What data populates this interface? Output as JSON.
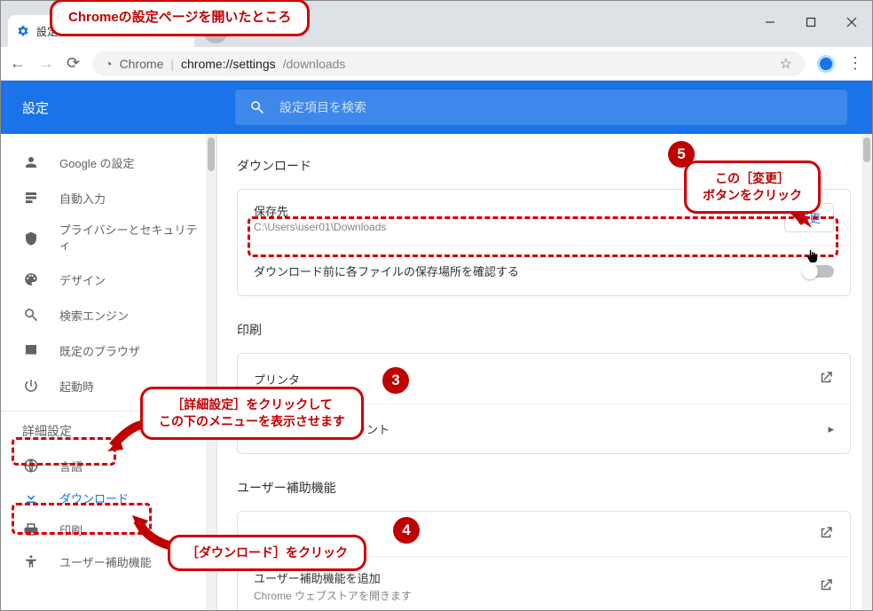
{
  "tab": {
    "title": "設定"
  },
  "addressbar": {
    "secure_label": "Chrome",
    "url_main": "chrome://settings",
    "url_rest": "/downloads"
  },
  "header": {
    "title": "設定",
    "search_placeholder": "設定項目を検索"
  },
  "sidebar": {
    "items": [
      {
        "label": "Google の設定"
      },
      {
        "label": "自動入力"
      },
      {
        "label": "プライバシーとセキュリティ"
      },
      {
        "label": "デザイン"
      },
      {
        "label": "検索エンジン"
      },
      {
        "label": "既定のブラウザ"
      },
      {
        "label": "起動時"
      }
    ],
    "advanced_label": "詳細設定",
    "sub_items": [
      {
        "label": "言語"
      },
      {
        "label": "ダウンロード"
      },
      {
        "label": "印刷"
      },
      {
        "label": "ユーザー補助機能"
      }
    ]
  },
  "main": {
    "download_section_title": "ダウンロード",
    "download_location_label": "保存先",
    "download_location_value": "C:\\Users\\user01\\Downloads",
    "download_change_button": "変更",
    "download_ask_label": "ダウンロード前に各ファイルの保存場所を確認する",
    "print_section_title": "印刷",
    "print_row_label": "プリンタ",
    "cloudprint_label": "Google クラウド プリント",
    "a11y_section_title": "ユーザー補助機能",
    "a11y_row1_main": "ユーザー補助機能を追加",
    "a11y_row1_sub": "Chrome ウェブストアを開きます"
  },
  "annotations": {
    "callout_top": "Chromeの設定ページを開いたところ",
    "callout_3_line1": "［詳細設定］をクリックして",
    "callout_3_line2": "この下のメニューを表示させます",
    "callout_4": "［ダウンロード］をクリック",
    "callout_5_line1": "この［変更］",
    "callout_5_line2": "ボタンをクリック",
    "badge3": "3",
    "badge4": "4",
    "badge5": "5"
  }
}
